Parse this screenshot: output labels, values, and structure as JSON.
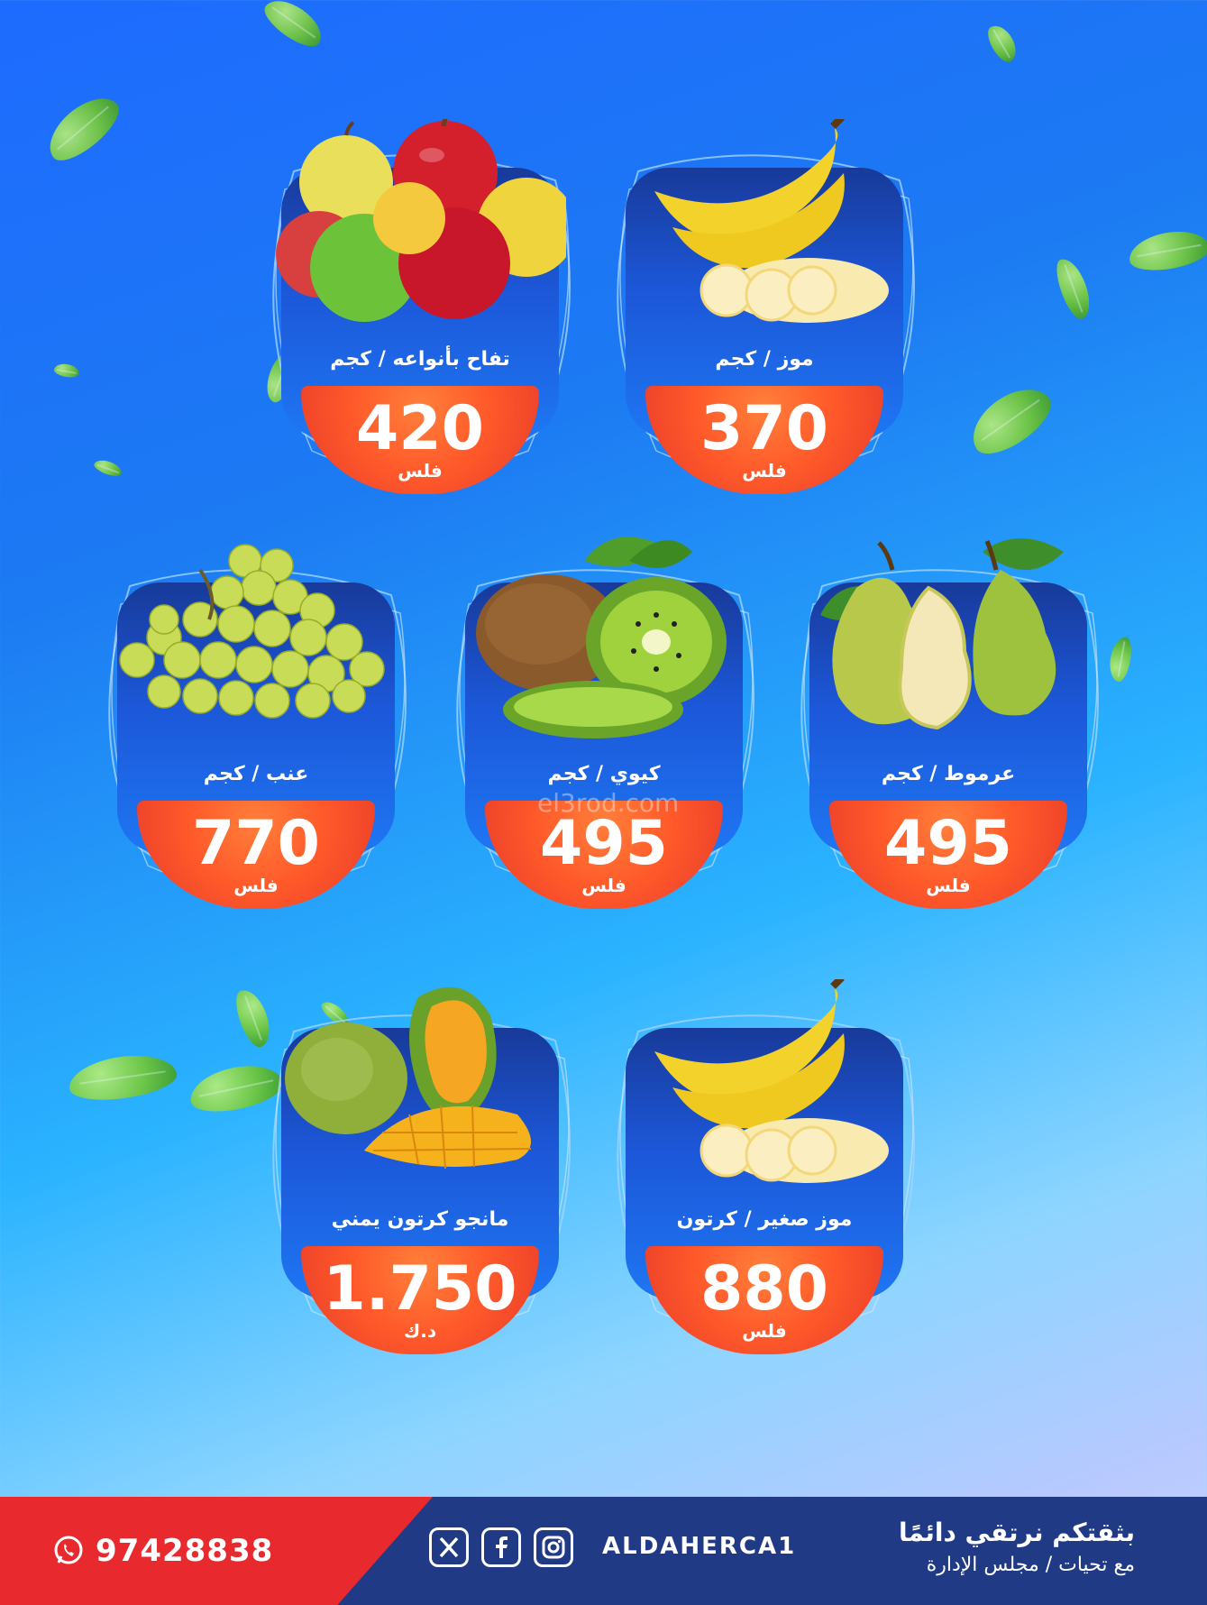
{
  "products": [
    {
      "name": "تفاح بأنواعه / كجم",
      "price": "420",
      "currency": "فلس",
      "icon": "apples-icon"
    },
    {
      "name": "موز / كجم",
      "price": "370",
      "currency": "فلس",
      "icon": "banana-icon"
    },
    {
      "name": "عنب / كجم",
      "price": "770",
      "currency": "فلس",
      "icon": "grapes-icon"
    },
    {
      "name": "كيوي / كجم",
      "price": "495",
      "currency": "فلس",
      "icon": "kiwi-icon"
    },
    {
      "name": "عرموط / كجم",
      "price": "495",
      "currency": "فلس",
      "icon": "pear-icon"
    },
    {
      "name": "مانجو كرتون يمني",
      "price": "1.750",
      "currency": "د.ك",
      "icon": "mango-icon"
    },
    {
      "name": "موز صغير / كرتون",
      "price": "880",
      "currency": "فلس",
      "icon": "banana-icon"
    }
  ],
  "watermark": "el3rod.com",
  "footer": {
    "phone": "97428838",
    "handle": "ALDAHERCA1",
    "slogan_line1": "بثقتكم نرتقي دائمًا",
    "slogan_line2": "مع تحيات / مجلس الإدارة",
    "icons": [
      "whatsapp-icon",
      "x-icon",
      "facebook-icon",
      "instagram-icon"
    ],
    "colors": {
      "primary": "#203a86",
      "accent": "#e82a2e"
    }
  },
  "colors": {
    "price_band": "#ff5a2a",
    "card_panel": "#1c57d8",
    "background_top": "#1e6bff",
    "background_bottom": "#c6d2ff"
  }
}
